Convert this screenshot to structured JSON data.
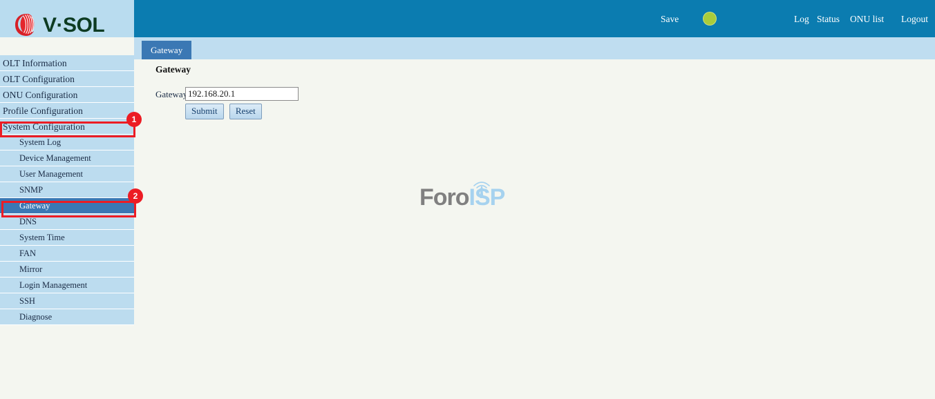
{
  "brand": {
    "logo_icon": "vsol-globe-icon",
    "name": "V·SOL"
  },
  "header": {
    "save_label": "Save",
    "status_indicator": "status-dot-green",
    "status_color": "#a9cc3b",
    "links": [
      {
        "label": "Log"
      },
      {
        "label": "Status"
      },
      {
        "label": "ONU list"
      },
      {
        "label": "Logout"
      }
    ]
  },
  "tabs": [
    {
      "label": "Gateway",
      "active": true
    }
  ],
  "main": {
    "title": "Gateway",
    "form": {
      "gateway_label": "Gateway",
      "gateway_value": "192.168.20.1",
      "gateway_placeholder": "",
      "submit_label": "Submit",
      "reset_label": "Reset"
    },
    "watermark": {
      "text_primary": "Foro",
      "text_secondary": "ISP",
      "icon": "antenna-tower-icon"
    }
  },
  "sidebar": {
    "top_items": [
      {
        "label": "OLT Information"
      },
      {
        "label": "OLT Configuration"
      },
      {
        "label": "ONU Configuration"
      },
      {
        "label": "Profile Configuration"
      },
      {
        "label": "System Configuration",
        "expanded": true
      }
    ],
    "sub_items": [
      {
        "label": "System Log"
      },
      {
        "label": "Device Management"
      },
      {
        "label": "User Management"
      },
      {
        "label": "SNMP"
      },
      {
        "label": "Gateway",
        "selected": true
      },
      {
        "label": "DNS"
      },
      {
        "label": "System Time"
      },
      {
        "label": "FAN"
      },
      {
        "label": "Mirror"
      },
      {
        "label": "Login Management"
      },
      {
        "label": "SSH"
      },
      {
        "label": "Diagnose"
      }
    ]
  },
  "annotations": [
    {
      "badge": "1",
      "target": "System Configuration",
      "color": "#ec1c24"
    },
    {
      "badge": "2",
      "target": "Gateway",
      "color": "#ec1c24"
    }
  ],
  "colors": {
    "header_blue": "#0b7cb0",
    "tab_active_blue": "#3b78b4",
    "sidebar_blue": "#bcdcef",
    "content_bg": "#f4f6f0",
    "annotation_red": "#ec1c24"
  }
}
